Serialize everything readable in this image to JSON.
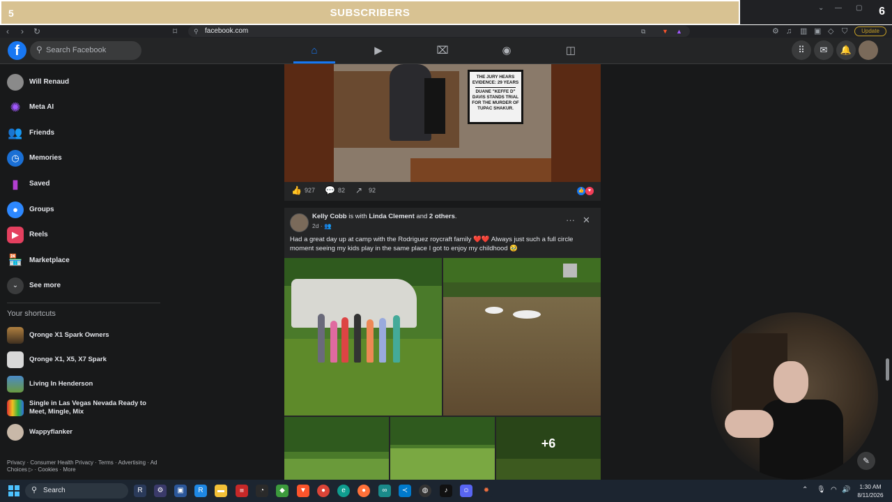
{
  "overlay": {
    "banner_title": "SUBSCRIBERS",
    "left_number": "5",
    "right_number": "6"
  },
  "browser": {
    "url": "facebook.com",
    "update_label": "Update"
  },
  "fb_header": {
    "search_placeholder": "Search Facebook",
    "nav_tabs": [
      "home",
      "video",
      "marketplace",
      "groups",
      "gaming"
    ],
    "active_tab": "home"
  },
  "sidebar": {
    "items": [
      {
        "label": "Will Renaud",
        "icon": "avatar",
        "color": "#8a8a8a"
      },
      {
        "label": "Meta AI",
        "icon": "meta-ai-icon",
        "color": "#a259ff"
      },
      {
        "label": "Friends",
        "icon": "friends-icon",
        "color": "#2d88ff"
      },
      {
        "label": "Memories",
        "icon": "memories-icon",
        "color": "#1a6fd4"
      },
      {
        "label": "Saved",
        "icon": "saved-icon",
        "color": "#b33fd1"
      },
      {
        "label": "Groups",
        "icon": "groups-icon",
        "color": "#2d88ff"
      },
      {
        "label": "Reels",
        "icon": "reels-icon",
        "color": "#e4405f"
      },
      {
        "label": "Marketplace",
        "icon": "marketplace-icon",
        "color": "#2d88ff"
      },
      {
        "label": "See more",
        "icon": "chevron-down-icon",
        "color": "#3a3b3c"
      }
    ],
    "shortcuts_heading": "Your shortcuts",
    "shortcuts": [
      {
        "label": "Qronge X1 Spark Owners"
      },
      {
        "label": "Qronge X1, X5, X7 Spark"
      },
      {
        "label": "Living In Henderson"
      },
      {
        "label": "Single in Las Vegas Nevada Ready to Meet, Mingle, Mix"
      },
      {
        "label": "Wappyflanker"
      }
    ],
    "footer": "Privacy · Consumer Health Privacy · Terms · Advertising · Ad Choices ▷ · Cookies · More"
  },
  "post1": {
    "sign_lines": [
      "THE JURY HEARS",
      "EVIDENCE: 29 YEARS",
      "DUANE \"KEFFE D\"",
      "DAVIS STANDS TRIAL",
      "FOR THE MURDER OF",
      "TUPAC SHAKUR."
    ],
    "likes": "927",
    "comments": "82",
    "shares": "92"
  },
  "post2": {
    "author": "Kelly Cobb",
    "with_text": " is with ",
    "tagged": "Linda Clement",
    "and_text": " and ",
    "others": "2 others",
    "period": ".",
    "time": "2d",
    "body": "Had a great day up at camp with the Rodriguez roycraft family ❤️❤️ Always just such a full circle moment seeing my kids play in the same place I got to enjoy my childhood 🥹",
    "more_photos": "+6"
  },
  "taskbar": {
    "search_placeholder": "Search",
    "time": "1:30 AM",
    "date": "8/11/2026"
  }
}
